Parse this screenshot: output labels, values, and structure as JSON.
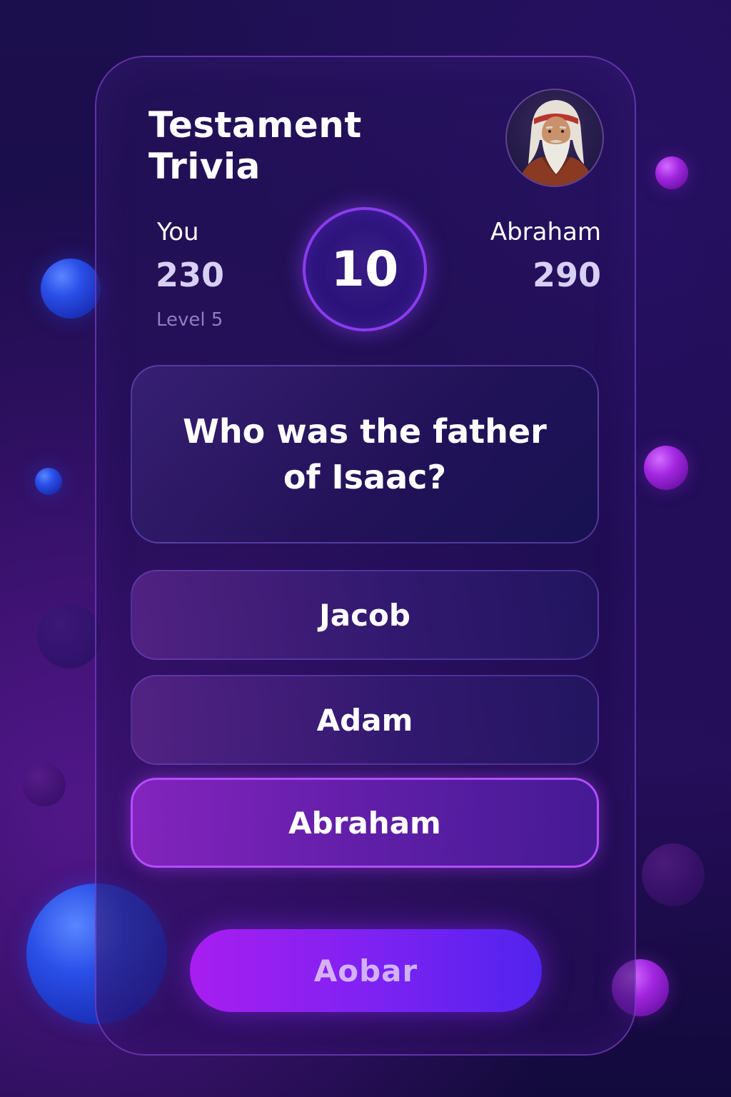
{
  "header": {
    "title": "Testament Trivia",
    "opponent_avatar_icon": "bearded-elder-portrait"
  },
  "players": {
    "you": {
      "label": "You",
      "score": "230",
      "level": "Level 5"
    },
    "opponent": {
      "label": "Abraham",
      "score": "290"
    }
  },
  "timer": {
    "value": "10"
  },
  "question": {
    "text": "Who was the father of Isaac?"
  },
  "answers": [
    {
      "label": "Jacob",
      "selected": false
    },
    {
      "label": "Adam",
      "selected": false
    },
    {
      "label": "Abraham",
      "selected": true
    }
  ],
  "submit": {
    "label": "Aobar"
  },
  "colors": {
    "accent": "#8a3cf0",
    "selected_border": "#b44cff",
    "button_gradient_start": "#a81ef0",
    "button_gradient_end": "#5223ee"
  }
}
